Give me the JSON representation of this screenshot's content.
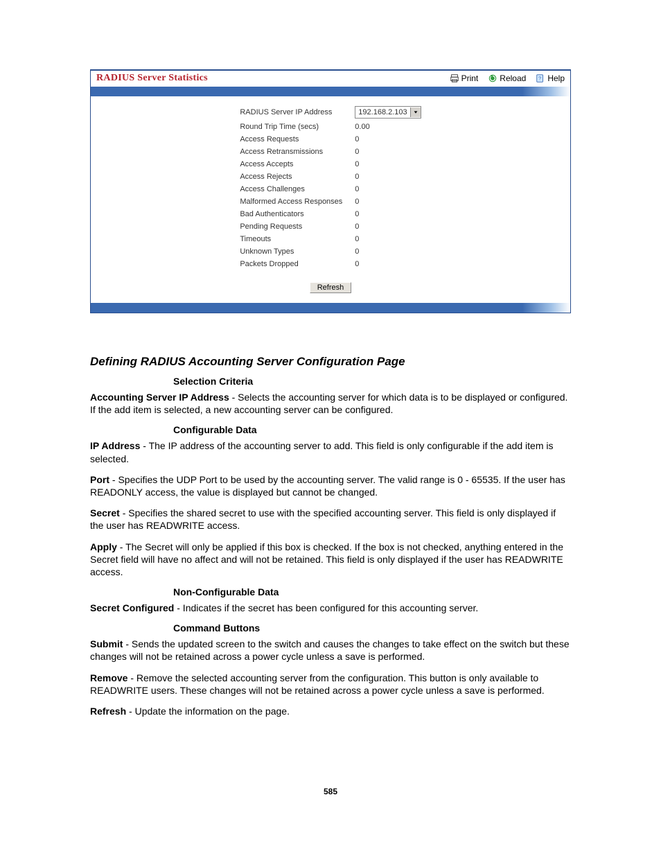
{
  "panel": {
    "title": "RADIUS Server Statistics",
    "actions": {
      "print": "Print",
      "reload": "Reload",
      "help": "Help"
    },
    "ip_dropdown": "192.168.2.103",
    "stats": [
      {
        "label": "RADIUS Server IP Address",
        "value": "__dropdown__"
      },
      {
        "label": "Round Trip Time (secs)",
        "value": "0.00"
      },
      {
        "label": "Access Requests",
        "value": "0"
      },
      {
        "label": "Access Retransmissions",
        "value": "0"
      },
      {
        "label": "Access Accepts",
        "value": "0"
      },
      {
        "label": "Access Rejects",
        "value": "0"
      },
      {
        "label": "Access Challenges",
        "value": "0"
      },
      {
        "label": "Malformed Access Responses",
        "value": "0"
      },
      {
        "label": "Bad Authenticators",
        "value": "0"
      },
      {
        "label": "Pending Requests",
        "value": "0"
      },
      {
        "label": "Timeouts",
        "value": "0"
      },
      {
        "label": "Unknown Types",
        "value": "0"
      },
      {
        "label": "Packets Dropped",
        "value": "0"
      }
    ],
    "refresh_label": "Refresh"
  },
  "doc": {
    "heading": "Defining RADIUS Accounting Server Configuration Page",
    "sub_selection": "Selection Criteria",
    "p_acct_ip_term": "Accounting Server IP Address",
    "p_acct_ip_text": " - Selects the accounting server for which data is to be displayed or configured. If the add item is selected, a new accounting server can be configured.",
    "sub_config": "Configurable Data",
    "p_ip_term": "IP Address",
    "p_ip_text": " - The IP address of the accounting server to add. This field is only configurable if the add item is selected.",
    "p_port_term": "Port",
    "p_port_text": " - Specifies the UDP Port to be used by the accounting server. The valid range is 0 - 65535. If the user has READONLY access, the value is displayed but cannot be changed.",
    "p_secret_term": "Secret",
    "p_secret_text": " - Specifies the shared secret to use with the specified accounting server. This field is only displayed if the user has READWRITE access.",
    "p_apply_term": "Apply",
    "p_apply_text": " - The Secret will only be applied if this box is checked. If the box is not checked, anything entered in the Secret field will have no affect and will not be retained. This field is only displayed if the user has READWRITE access.",
    "sub_nonconfig": "Non-Configurable Data",
    "p_secconf_term": "Secret Configured",
    "p_secconf_text": " - Indicates if the secret has been configured for this accounting server.",
    "sub_cmd": "Command Buttons",
    "p_submit_term": "Submit",
    "p_submit_text": " - Sends the updated screen to the switch and causes the changes to take effect on the switch but these changes will not be retained across a power cycle unless a save is performed.",
    "p_remove_term": "Remove",
    "p_remove_text": " - Remove the selected accounting server from the configuration. This button is only available to READWRITE users. These changes will not be retained across a power cycle unless a save is performed.",
    "p_refresh_term": "Refresh",
    "p_refresh_text": " - Update the information on the page.",
    "pagenum": "585"
  }
}
